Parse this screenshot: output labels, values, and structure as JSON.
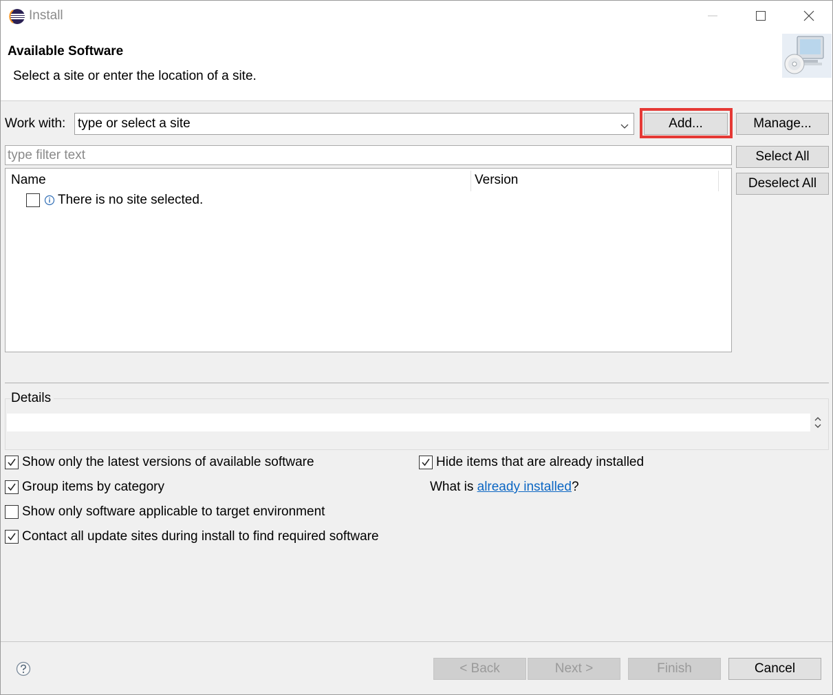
{
  "window": {
    "title": "Install",
    "controls": [
      "minimize",
      "maximize",
      "close"
    ]
  },
  "banner": {
    "title": "Available Software",
    "description": "Select a site or enter the location of a site.",
    "icon": "cd-computer-icon"
  },
  "work_with": {
    "label": "Work with:",
    "value": "type or select a site",
    "add_label": "Add...",
    "manage_label": "Manage...",
    "highlight_color": "#e53935"
  },
  "filter": {
    "placeholder": "type filter text"
  },
  "side_buttons": {
    "select_all": "Select All",
    "deselect_all": "Deselect All"
  },
  "table": {
    "columns": [
      "Name",
      "Version"
    ],
    "rows": [
      {
        "checked": false,
        "icon": "info-icon",
        "text": "There is no site selected."
      }
    ]
  },
  "details": {
    "label": "Details",
    "text": ""
  },
  "options": {
    "latest_versions": {
      "label": "Show only the latest versions of available software",
      "checked": true
    },
    "group_by_category": {
      "label": "Group items by category",
      "checked": true
    },
    "applicable_only": {
      "label": "Show only software applicable to target environment",
      "checked": false
    },
    "contact_sites": {
      "label": "Contact all update sites during install to find required software",
      "checked": true
    },
    "hide_installed": {
      "label": "Hide items that are already installed",
      "checked": true
    }
  },
  "installed_link": {
    "prefix": "What is ",
    "link_text": "already installed",
    "suffix": "?",
    "link_color": "#0b66c3"
  },
  "footer": {
    "back": "< Back",
    "next": "Next >",
    "finish": "Finish",
    "cancel": "Cancel"
  }
}
